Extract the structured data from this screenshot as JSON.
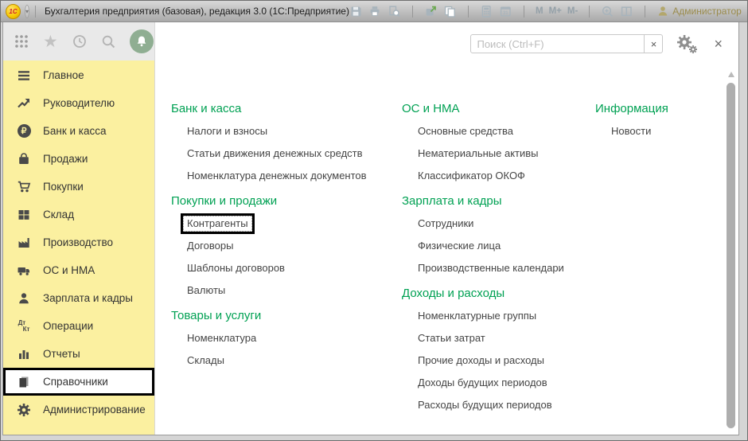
{
  "window": {
    "title": "Бухгалтерия предприятия (базовая), редакция 3.0  (1С:Предприятие)",
    "logo_text": "1С",
    "memory_buttons": [
      "M",
      "M+",
      "M-"
    ],
    "calendar_day": "31",
    "info_letter": "i",
    "user_name": "Администратор"
  },
  "quickbar": {
    "star_glyph": "★"
  },
  "sidebar": {
    "selected_item": "Справочники",
    "ruble_glyph": "₽",
    "operations_glyph": {
      "debit": "Дт",
      "credit": "Кт"
    },
    "items": [
      "Главное",
      "Руководителю",
      "Банк и касса",
      "Продажи",
      "Покупки",
      "Склад",
      "Производство",
      "ОС и НМА",
      "Зарплата и кадры",
      "Операции",
      "Отчеты",
      "Справочники",
      "Администрирование"
    ]
  },
  "panel": {
    "search_placeholder": "Поиск (Ctrl+F)",
    "search_clear_glyph": "×",
    "close_glyph": "×",
    "highlighted_link": "Контрагенты",
    "columns": [
      {
        "sections": [
          {
            "title": "Банк и касса",
            "items": [
              "Налоги и взносы",
              "Статьи движения денежных средств",
              "Номенклатура денежных документов"
            ]
          },
          {
            "title": "Покупки и продажи",
            "items": [
              "Контрагенты",
              "Договоры",
              "Шаблоны договоров",
              "Валюты"
            ]
          },
          {
            "title": "Товары и услуги",
            "items": [
              "Номенклатура",
              "Склады"
            ]
          }
        ]
      },
      {
        "sections": [
          {
            "title": "ОС и НМА",
            "items": [
              "Основные средства",
              "Нематериальные активы",
              "Классификатор ОКОФ"
            ]
          },
          {
            "title": "Зарплата и кадры",
            "items": [
              "Сотрудники",
              "Физические лица",
              "Производственные календари"
            ]
          },
          {
            "title": "Доходы и расходы",
            "items": [
              "Номенклатурные группы",
              "Статьи затрат",
              "Прочие доходы и расходы",
              "Доходы будущих периодов",
              "Расходы будущих периодов"
            ]
          }
        ]
      },
      {
        "sections": [
          {
            "title": "Информация",
            "items": [
              "Новости"
            ]
          }
        ]
      }
    ]
  },
  "colors": {
    "header_green": "#00a153",
    "sidebar_yellow": "#fbf0a0",
    "selection_border": "#000000",
    "logo_red": "#d21f26"
  }
}
